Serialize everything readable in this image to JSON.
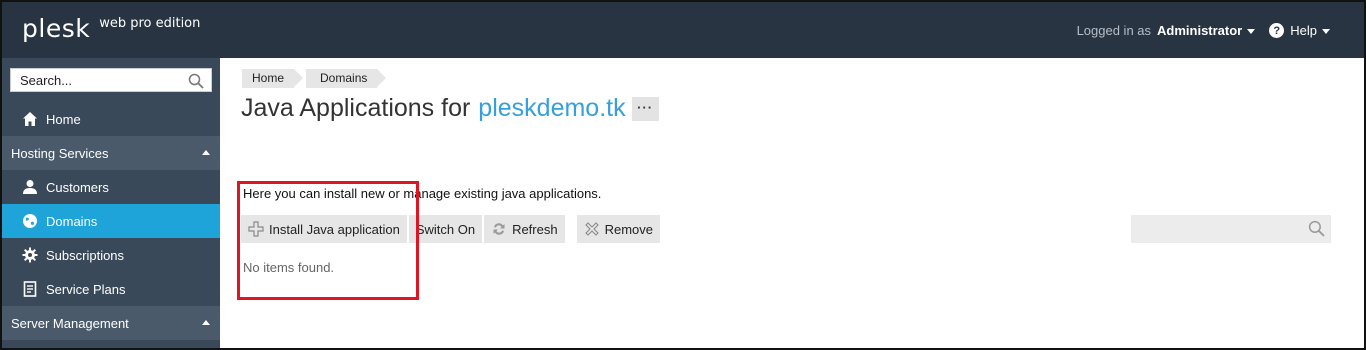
{
  "header": {
    "logo_text": "plesk",
    "edition": "web pro edition",
    "logged_in_label": "Logged in as",
    "user": "Administrator",
    "help": "Help"
  },
  "sidebar": {
    "search_text": "Search...",
    "items": [
      {
        "type": "item",
        "label": "Home",
        "icon": "home-icon"
      },
      {
        "type": "section",
        "label": "Hosting Services"
      },
      {
        "type": "item",
        "label": "Customers",
        "icon": "user-icon"
      },
      {
        "type": "item",
        "label": "Domains",
        "icon": "globe-icon",
        "active": true
      },
      {
        "type": "item",
        "label": "Subscriptions",
        "icon": "gear-icon"
      },
      {
        "type": "item",
        "label": "Service Plans",
        "icon": "document-icon"
      },
      {
        "type": "section",
        "label": "Server Management"
      }
    ]
  },
  "breadcrumb": [
    "Home",
    "Domains"
  ],
  "page": {
    "title_prefix": "Java Applications for",
    "domain": "pleskdemo.tk",
    "more": "···",
    "intro": "Here you can install new or manage existing java applications.",
    "empty": "No items found."
  },
  "toolbar": {
    "install": "Install Java application",
    "switch_on": "Switch On",
    "refresh": "Refresh",
    "remove": "Remove"
  },
  "colors": {
    "topbar": "#283442",
    "sidebar": "#39495a",
    "active": "#1ea4d8",
    "link": "#35a0dc",
    "highlight": "#e01523"
  }
}
